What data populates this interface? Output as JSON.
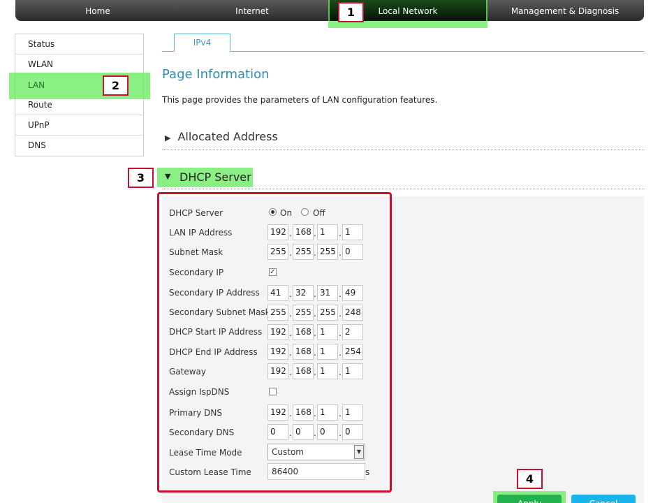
{
  "nav": {
    "items": [
      {
        "label": "Home"
      },
      {
        "label": "Internet"
      },
      {
        "label": "Local Network"
      },
      {
        "label": "Management & Diagnosis"
      }
    ]
  },
  "sidebar": {
    "items": [
      {
        "label": "Status"
      },
      {
        "label": "WLAN"
      },
      {
        "label": "LAN"
      },
      {
        "label": "Route"
      },
      {
        "label": "UPnP"
      },
      {
        "label": "DNS"
      }
    ]
  },
  "tab": {
    "label": "IPv4"
  },
  "page": {
    "title": "Page Information",
    "description": "This page provides the parameters of LAN configuration features."
  },
  "sections": {
    "allocated": "Allocated Address",
    "dhcp": "DHCP Server"
  },
  "callouts": [
    "1",
    "2",
    "3",
    "4"
  ],
  "form": {
    "dhcp_server": {
      "label": "DHCP Server",
      "on": "On",
      "off": "Off",
      "value": "On"
    },
    "lan_ip": {
      "label": "LAN IP Address",
      "octets": [
        "192",
        "168",
        "1",
        "1"
      ]
    },
    "subnet_mask": {
      "label": "Subnet Mask",
      "octets": [
        "255",
        "255",
        "255",
        "0"
      ]
    },
    "secondary_ip": {
      "label": "Secondary IP",
      "checked": true
    },
    "secondary_ip_address": {
      "label": "Secondary IP Address",
      "octets": [
        "41",
        "32",
        "31",
        "49"
      ]
    },
    "secondary_subnet_mask": {
      "label": "Secondary Subnet Mask",
      "octets": [
        "255",
        "255",
        "255",
        "248"
      ]
    },
    "dhcp_start": {
      "label": "DHCP Start IP Address",
      "octets": [
        "192",
        "168",
        "1",
        "2"
      ]
    },
    "dhcp_end": {
      "label": "DHCP End IP Address",
      "octets": [
        "192",
        "168",
        "1",
        "254"
      ]
    },
    "gateway": {
      "label": "Gateway",
      "octets": [
        "192",
        "168",
        "1",
        "1"
      ]
    },
    "assign_isp_dns": {
      "label": "Assign IspDNS",
      "checked": false
    },
    "primary_dns": {
      "label": "Primary DNS",
      "octets": [
        "192",
        "168",
        "1",
        "1"
      ]
    },
    "secondary_dns": {
      "label": "Secondary DNS",
      "octets": [
        "0",
        "0",
        "0",
        "0"
      ]
    },
    "lease_time_mode": {
      "label": "Lease Time Mode",
      "value": "Custom"
    },
    "custom_lease_time": {
      "label": "Custom Lease Time",
      "value": "86400",
      "unit": "s"
    }
  },
  "buttons": {
    "apply": "Apply",
    "cancel": "Cancel"
  },
  "colors": {
    "highlight": "#64EB5A",
    "callout_border": "#C8102E",
    "accent": "#2F8FB0",
    "apply": "#22B14C",
    "cancel": "#18B6E8"
  }
}
